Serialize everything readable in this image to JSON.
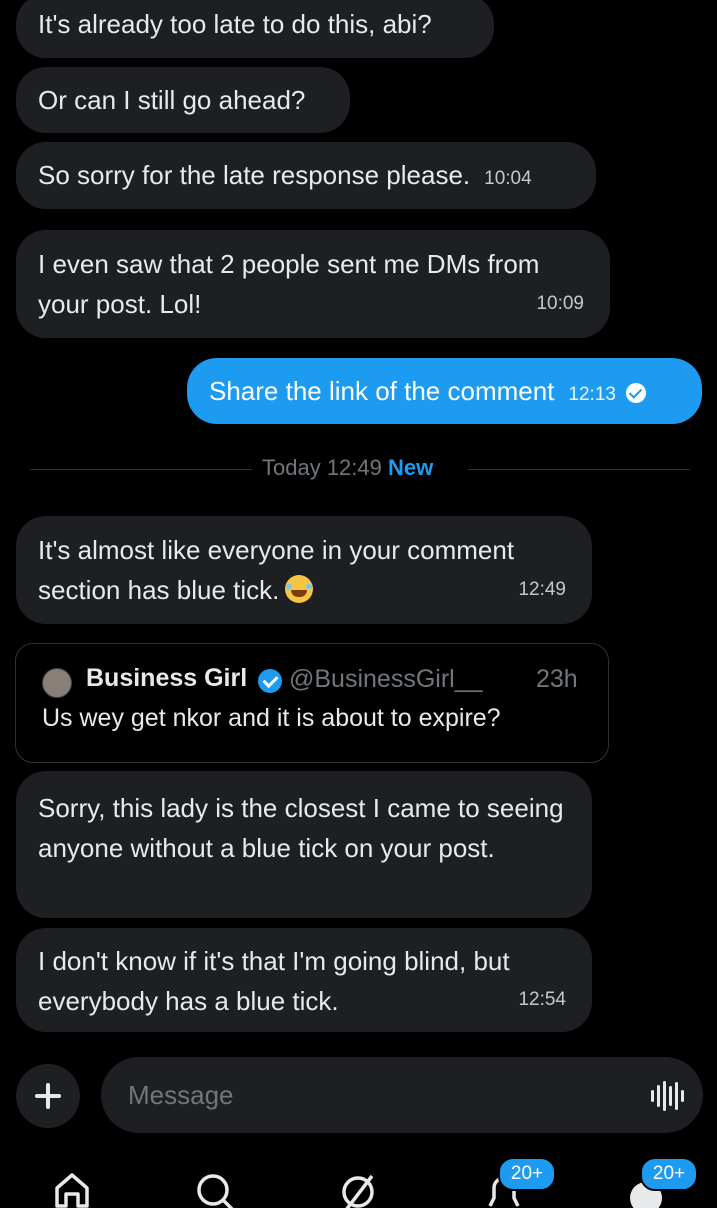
{
  "messages": [
    {
      "text": "It's already too late to do this, abi?",
      "time": ""
    },
    {
      "text": "Or can I still go ahead?",
      "time": ""
    },
    {
      "text": "So sorry for the late response please.",
      "time": "10:04"
    },
    {
      "text": "I even saw that 2 people sent me DMs from your post. Lol!",
      "time": "10:09"
    },
    {
      "text": "Share the link of the comment",
      "time": "12:13",
      "sent": true
    },
    {
      "text": "It's almost like everyone in your comment section has blue tick.",
      "time": "12:49",
      "emoji": "face-with-tears-of-joy"
    },
    {
      "text": "Sorry, this lady is the closest I came to seeing anyone without a blue tick on your post.",
      "time": ""
    },
    {
      "text": "I don't know if it's that I'm going blind, but everybody has a blue tick.",
      "time": "12:54"
    }
  ],
  "date_separator": {
    "label": "Today 12:49",
    "new_label": "New"
  },
  "quoted_post": {
    "name": "Business Girl",
    "handle": "@BusinessGirl__",
    "age": "23h",
    "text": "Us wey get nkor and it is about to expire?"
  },
  "composer": {
    "placeholder": "Message"
  },
  "nav": {
    "items": [
      "home-icon",
      "search-icon",
      "grok-icon",
      "notifications-icon",
      "messages-icon"
    ],
    "notifications_badge": "20+",
    "messages_badge": "20+"
  },
  "colors": {
    "accent": "#1d9bf0",
    "bubble": "#1d1f23",
    "background": "#000000"
  }
}
